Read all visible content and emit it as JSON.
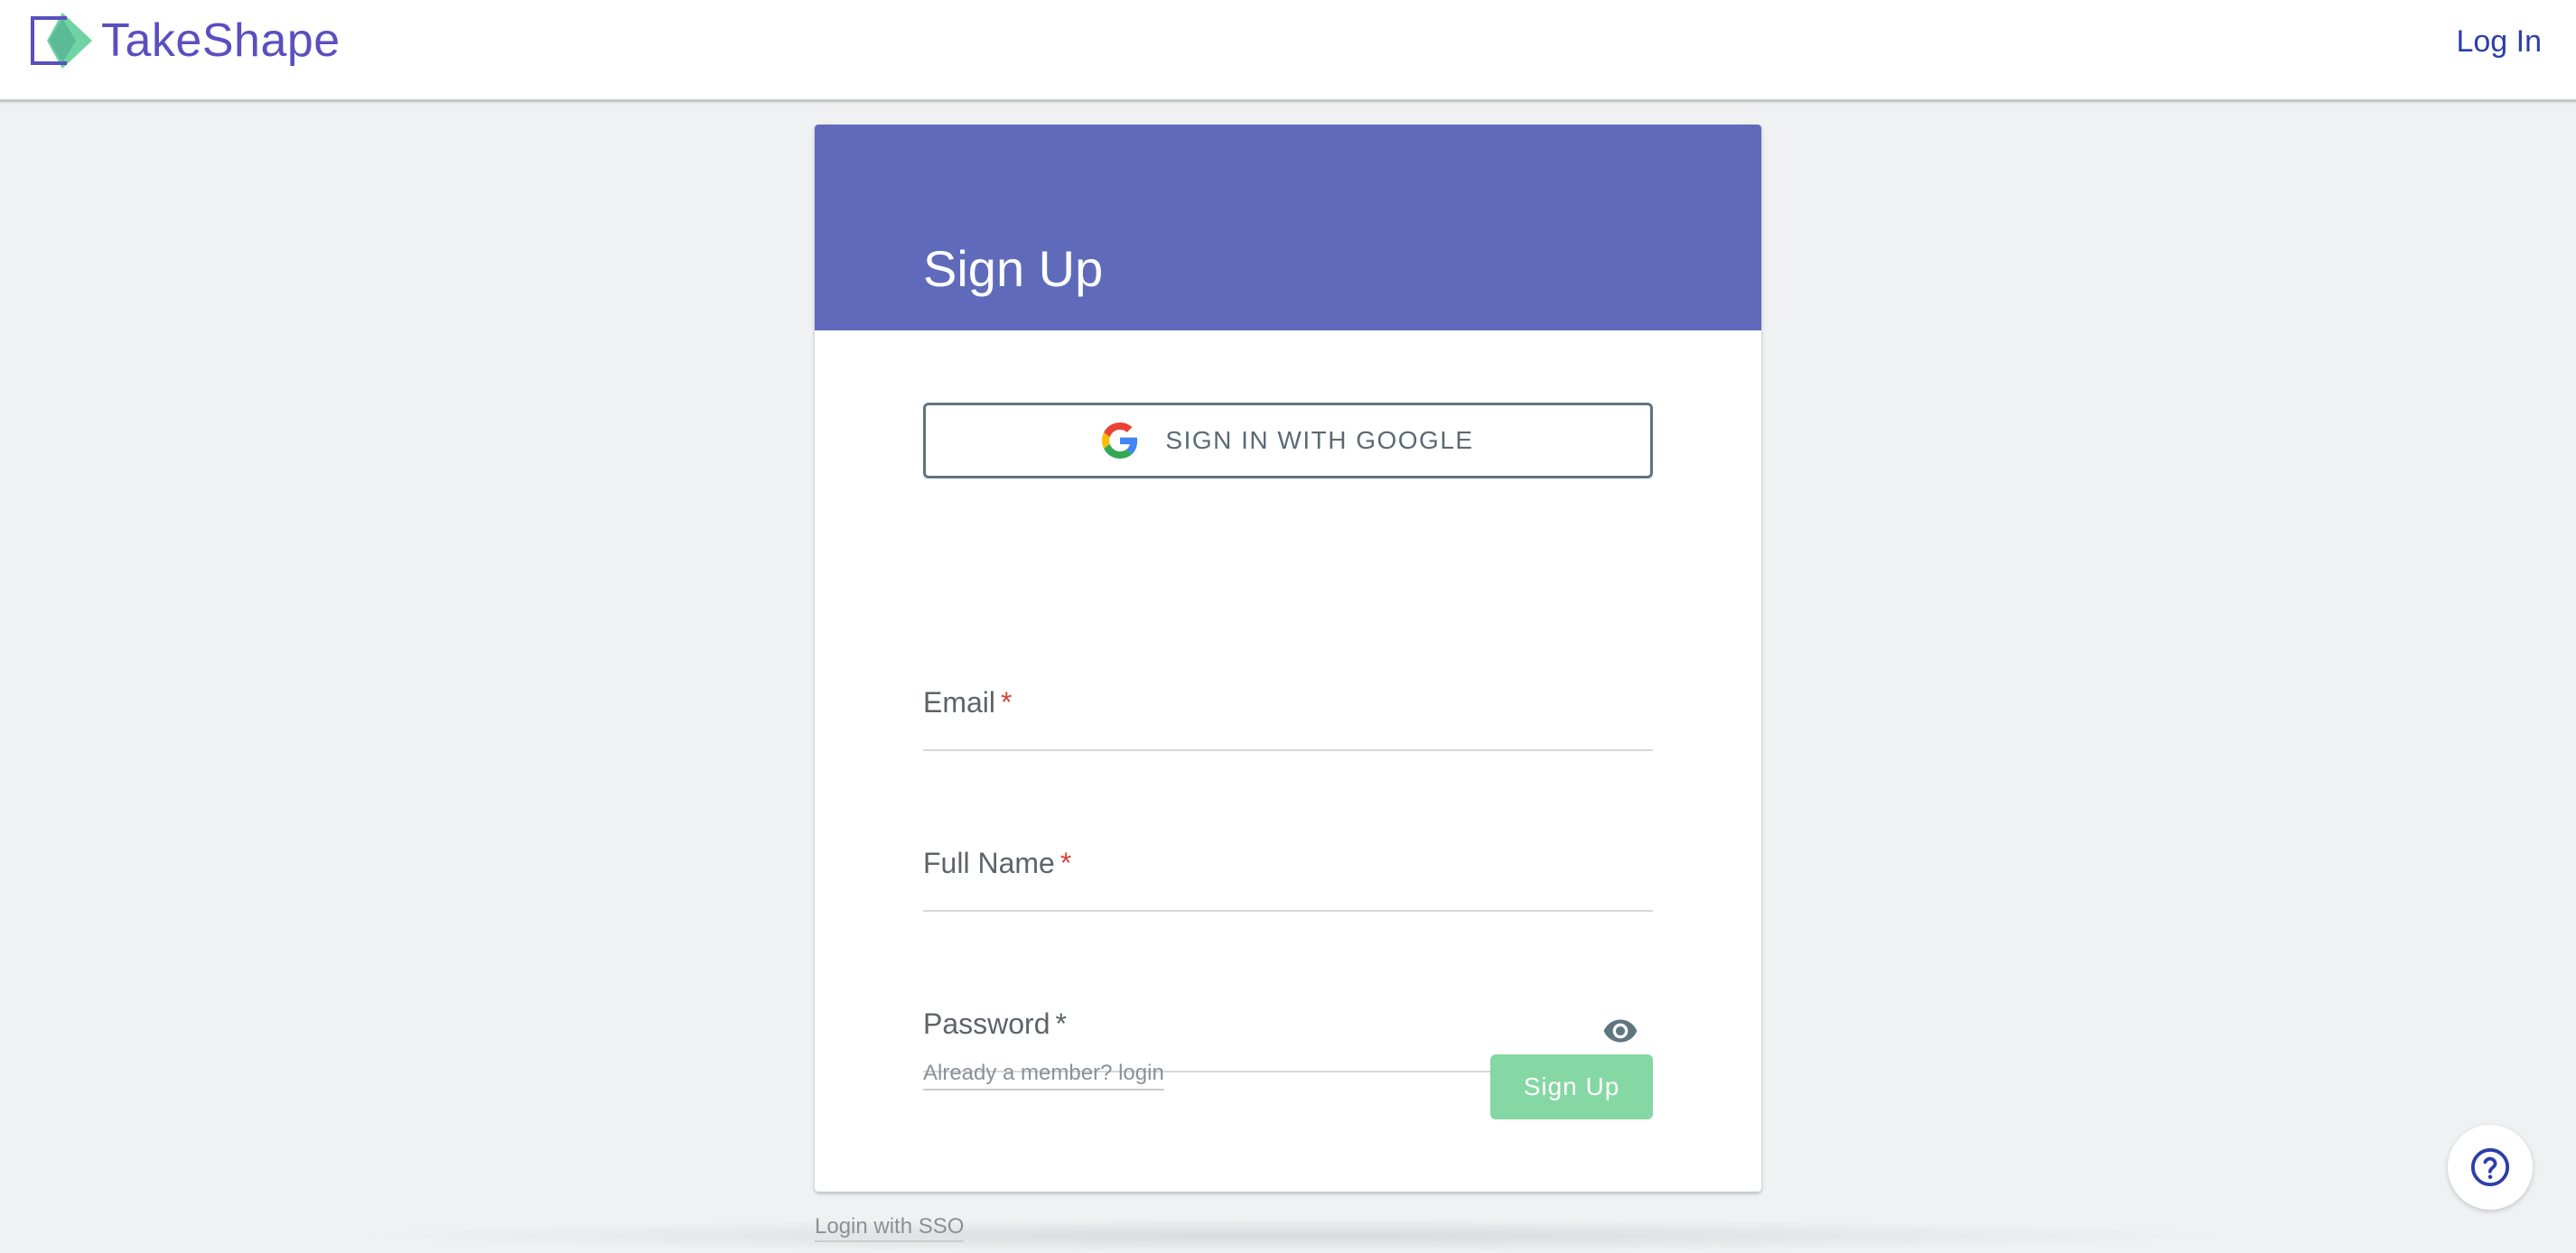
{
  "header": {
    "brand": "TakeShape",
    "login_label": "Log In"
  },
  "card": {
    "title": "Sign Up",
    "google_button_label": "SIGN IN WITH GOOGLE",
    "fields": {
      "email": {
        "label": "Email",
        "required_mark": "*"
      },
      "full_name": {
        "label": "Full Name",
        "required_mark": "*"
      },
      "password": {
        "label": "Password",
        "required_mark": "*"
      }
    },
    "member_link": "Already a member? login",
    "submit_label": "Sign Up"
  },
  "footer": {
    "sso_link": "Login with SSO"
  },
  "colors": {
    "brand": "#5a4fbf",
    "card_header": "#5f6bba",
    "submit": "#85d7a3",
    "required": "#d7453a",
    "logo_green": "#6fd3a4"
  },
  "icons": {
    "logo": "takeshape-logo-icon",
    "google": "google-icon",
    "password_toggle": "eye-icon",
    "help": "help-icon"
  }
}
